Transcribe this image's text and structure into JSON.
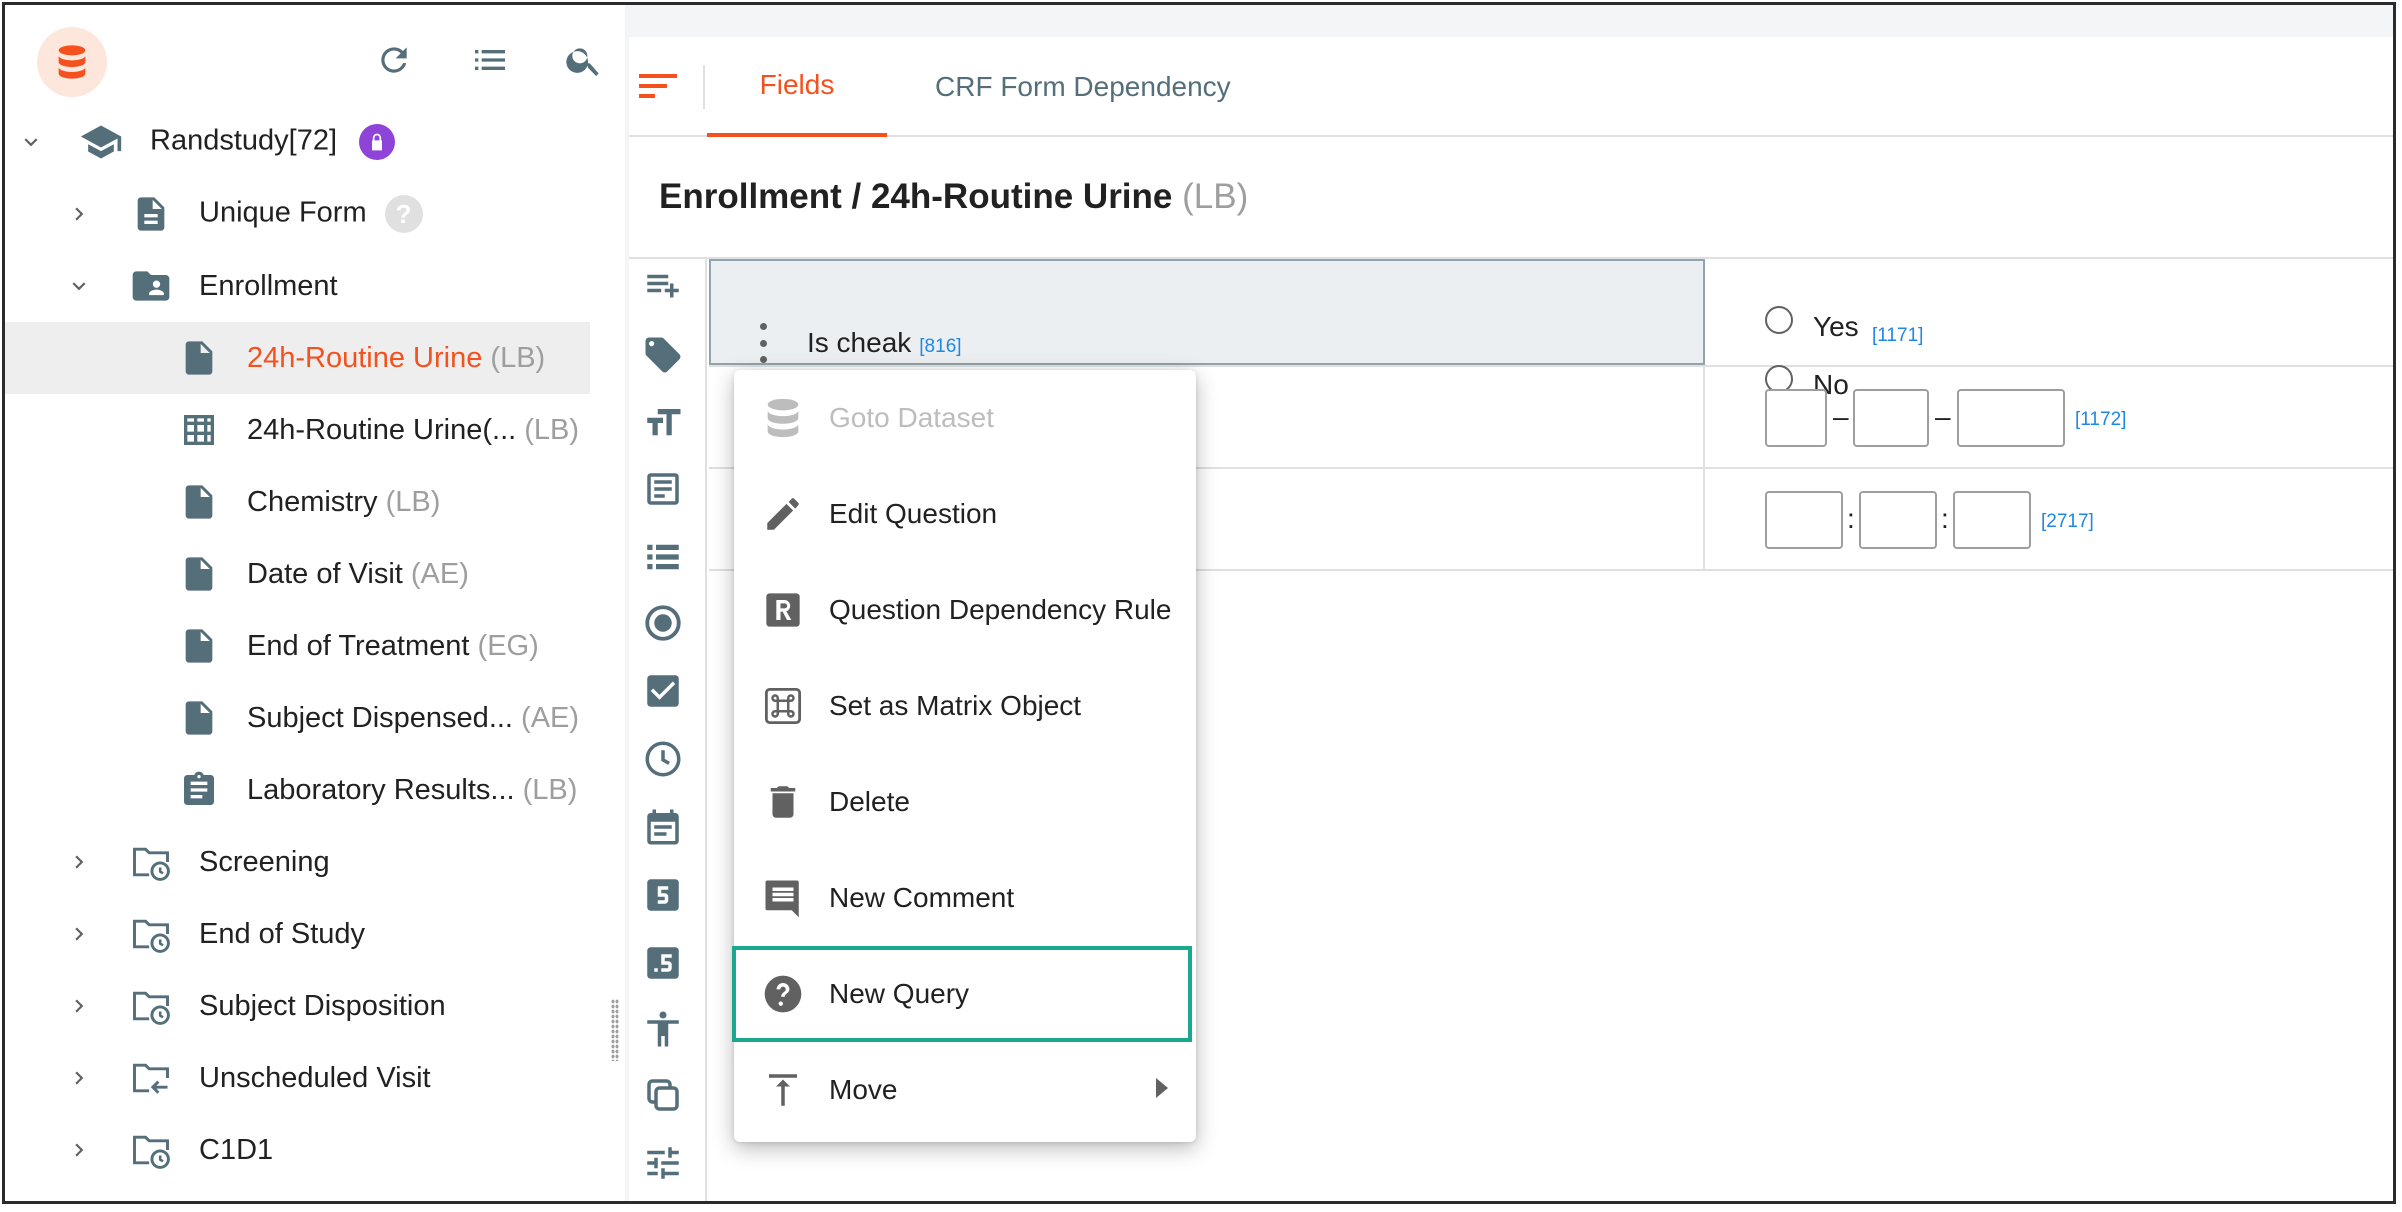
{
  "sidebar": {
    "tree": [
      {
        "label": "Randstudy[72]"
      },
      {
        "label": "Unique Form",
        "help": "?"
      },
      {
        "label": "Enrollment"
      },
      {
        "label": "24h-Routine Urine",
        "suffix": "(LB)"
      },
      {
        "label": "24h-Routine Urine(...",
        "suffix": "(LB)"
      },
      {
        "label": "Chemistry",
        "suffix": "(LB)"
      },
      {
        "label": "Date of Visit",
        "suffix": "(AE)"
      },
      {
        "label": "End of Treatment",
        "suffix": "(EG)"
      },
      {
        "label": "Subject Dispensed...",
        "suffix": "(AE)"
      },
      {
        "label": "Laboratory Results...",
        "suffix": "(LB)"
      },
      {
        "label": "Screening"
      },
      {
        "label": "End of Study"
      },
      {
        "label": "Subject Disposition"
      },
      {
        "label": "Unscheduled Visit"
      },
      {
        "label": "C1D1"
      }
    ]
  },
  "tabs": [
    {
      "label": "Fields",
      "active": true
    },
    {
      "label": "CRF Form Dependency",
      "active": false
    }
  ],
  "page": {
    "title": "Enrollment / 24h-Routine Urine",
    "title_suffix": "(LB)"
  },
  "questions": {
    "q1": {
      "text": "Is cheak",
      "id": "[816]",
      "options": [
        "Yes",
        "No"
      ],
      "option_id": "[1171]"
    },
    "q2": {
      "id": "[1172]",
      "separator": "–"
    },
    "q3": {
      "id": "[2717]",
      "separator": ":"
    }
  },
  "context_menu": {
    "items": [
      {
        "label": "Goto Dataset",
        "icon": "database-icon",
        "disabled": true
      },
      {
        "label": "Edit Question",
        "icon": "pencil-icon"
      },
      {
        "label": "Question Dependency Rule",
        "icon": "rule-r-icon"
      },
      {
        "label": "Set as Matrix Object",
        "icon": "command-icon"
      },
      {
        "label": "Delete",
        "icon": "trash-icon"
      },
      {
        "label": "New Comment",
        "icon": "comment-icon"
      },
      {
        "label": "New Query",
        "icon": "help-circle-icon",
        "highlighted": true
      },
      {
        "label": "Move",
        "icon": "move-top-icon",
        "submenu": true
      }
    ]
  },
  "colors": {
    "accent": "#f4511e",
    "highlight_border": "#1aa88f",
    "lock_badge": "#8e44d8",
    "link_blue": "#1e88e5",
    "icon_slate": "#546e7a"
  }
}
